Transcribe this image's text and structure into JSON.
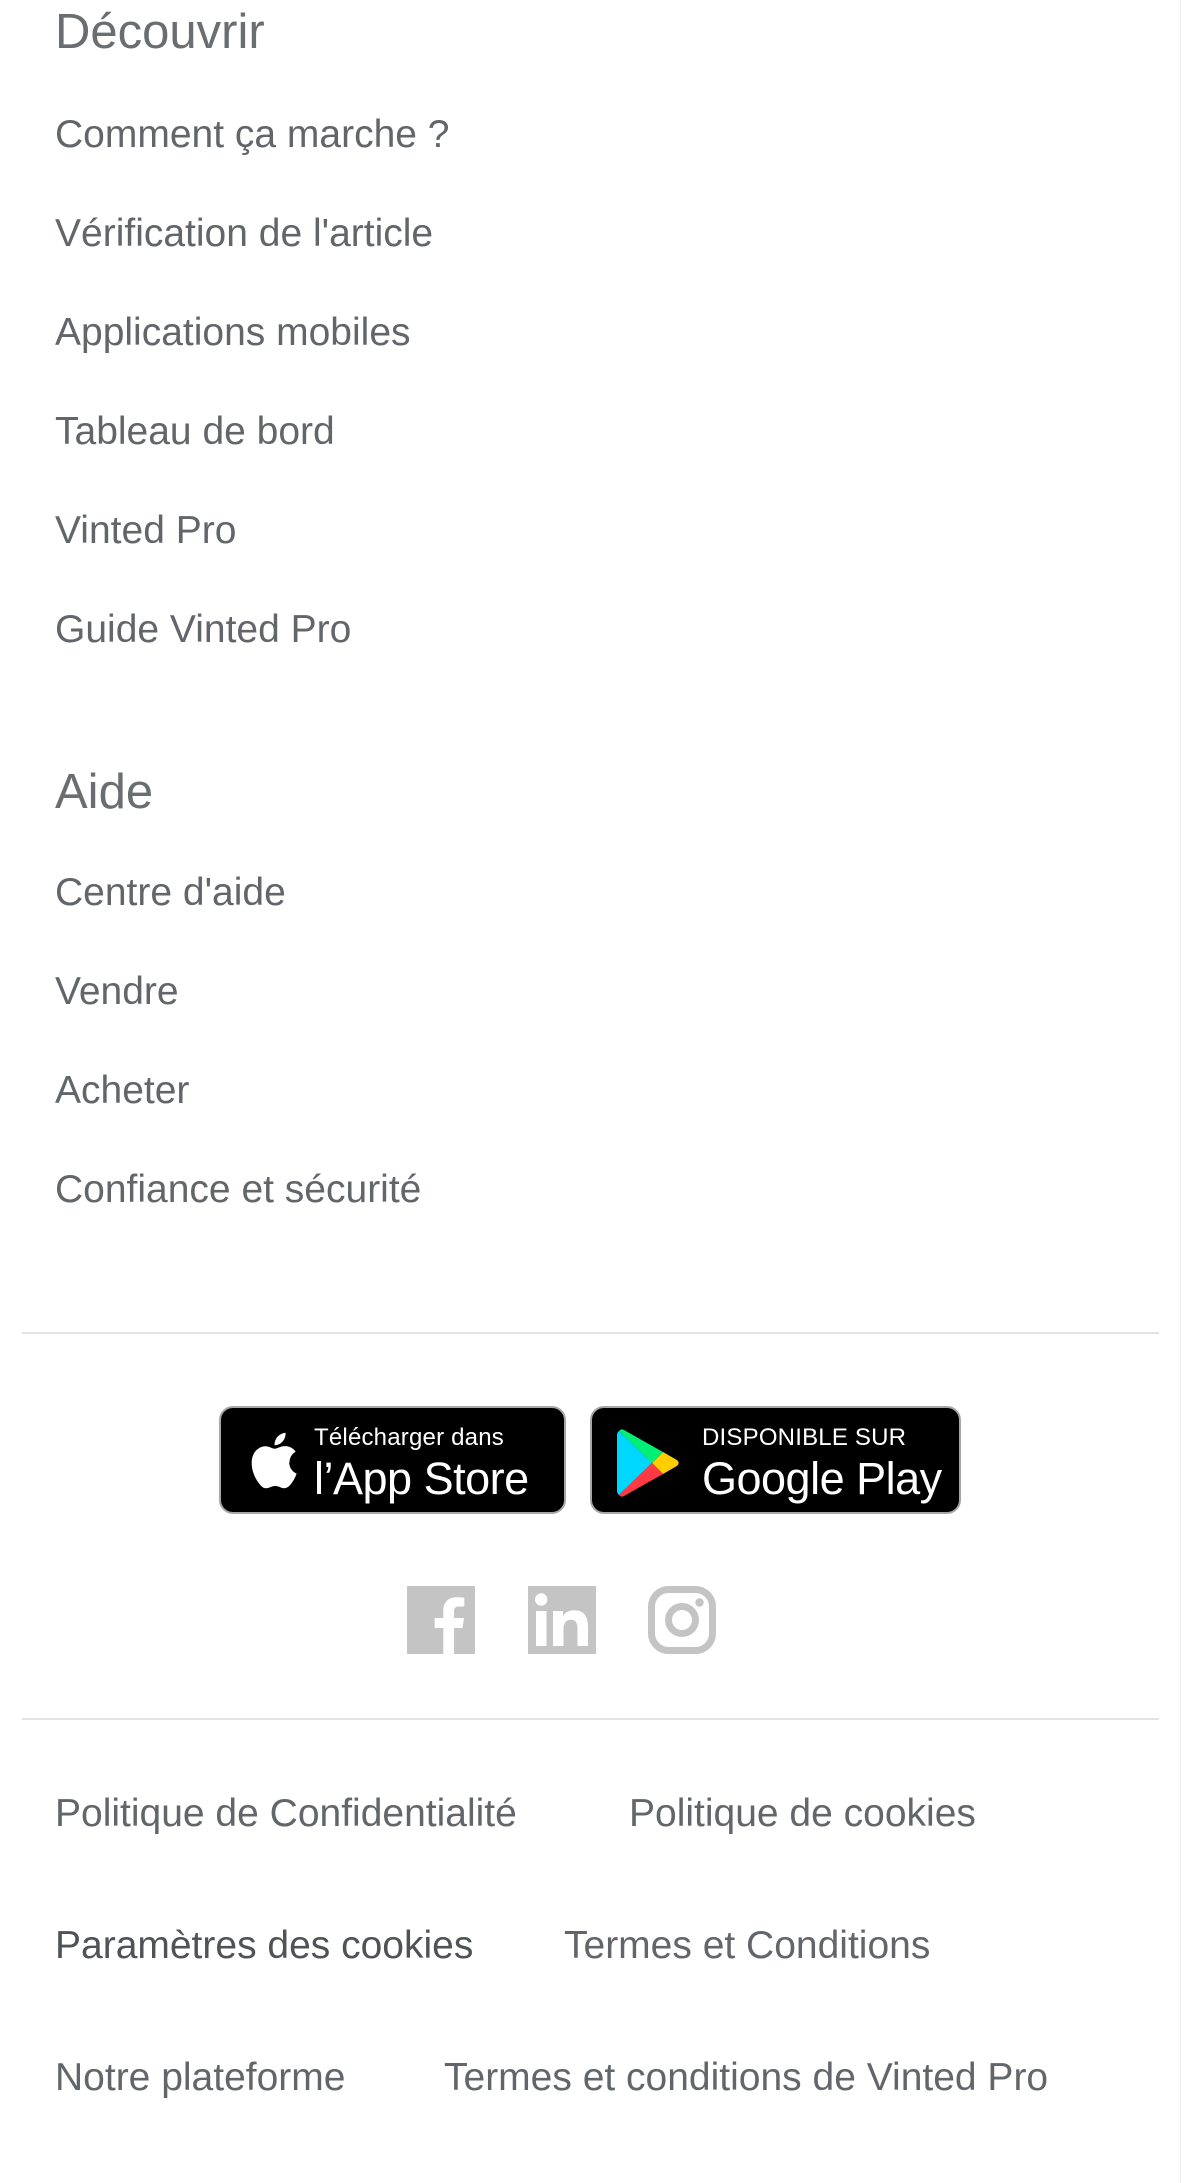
{
  "discover": {
    "title": "Découvrir",
    "links": [
      "Comment ça marche ?",
      "Vérification de l'article",
      "Applications mobiles",
      "Tableau de bord",
      "Vinted Pro",
      "Guide Vinted Pro"
    ]
  },
  "help": {
    "title": "Aide",
    "links": [
      "Centre d'aide",
      "Vendre",
      "Acheter",
      "Confiance et sécurité"
    ]
  },
  "app_badges": {
    "app_store": {
      "small": "Télécharger dans",
      "big": "l’App Store",
      "icon": "apple-icon"
    },
    "google_play": {
      "small": "DISPONIBLE SUR",
      "big": "Google Play",
      "icon": "google-play-icon"
    }
  },
  "social": {
    "icons": [
      "facebook-icon",
      "linkedin-icon",
      "instagram-icon"
    ],
    "color": "#c4c4c4"
  },
  "legal": {
    "privacy": "Politique de Confidentialité",
    "cookies_policy": "Politique de cookies",
    "cookie_settings": "Paramètres des cookies",
    "terms": "Termes et Conditions",
    "platform": "Notre plateforme",
    "pro_terms": "Termes et conditions de Vinted Pro"
  },
  "colors": {
    "text": "#62666a",
    "divider": "#e3e3e3",
    "badge_bg": "#000000"
  }
}
